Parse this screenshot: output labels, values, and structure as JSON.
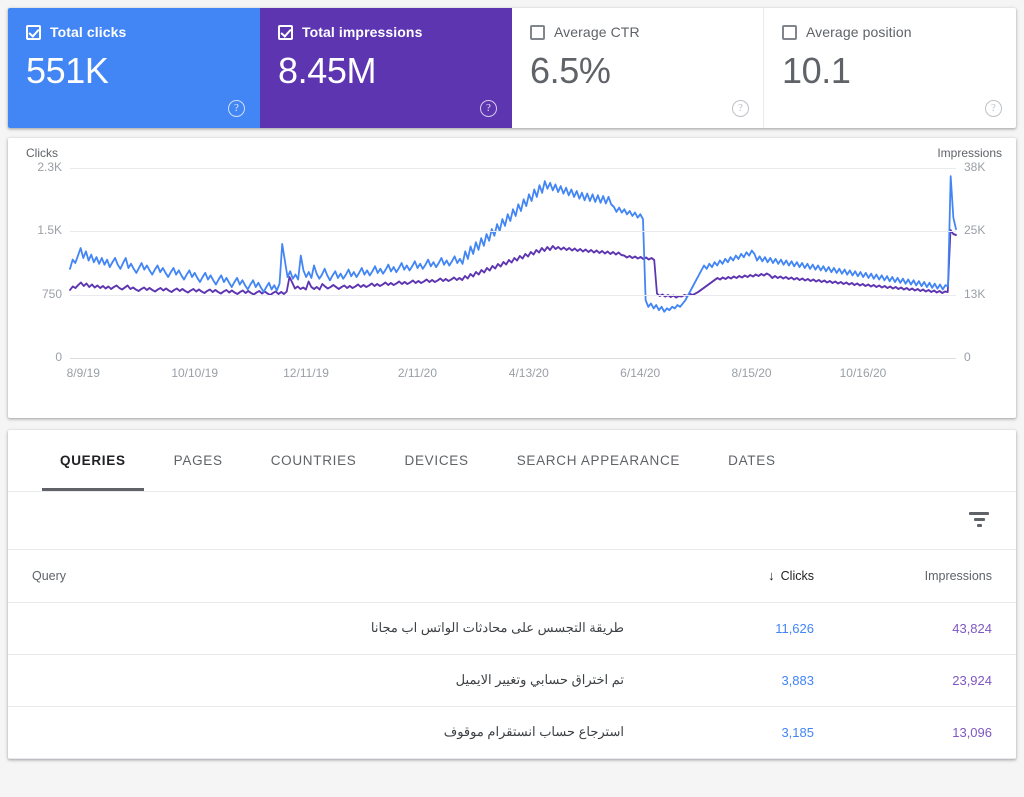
{
  "metrics": [
    {
      "label": "Total clicks",
      "value": "551K",
      "checked": true,
      "state": "sel-blue",
      "help": "?"
    },
    {
      "label": "Total impressions",
      "value": "8.45M",
      "checked": true,
      "state": "sel-purple",
      "help": "?"
    },
    {
      "label": "Average CTR",
      "value": "6.5%",
      "checked": false,
      "state": "",
      "help": "?"
    },
    {
      "label": "Average position",
      "value": "10.1",
      "checked": false,
      "state": "",
      "help": "?"
    }
  ],
  "chart": {
    "left_axis_title": "Clicks",
    "right_axis_title": "Impressions",
    "left_ticks": [
      "2.3K",
      "1.5K",
      "750",
      "0"
    ],
    "right_ticks": [
      "38K",
      "25K",
      "13K",
      "0"
    ],
    "x_ticks": [
      "8/9/19",
      "10/10/19",
      "12/11/19",
      "2/11/20",
      "4/13/20",
      "6/14/20",
      "8/15/20",
      "10/16/20"
    ],
    "clicks_color": "#4285f4",
    "impressions_color": "#5e35b1"
  },
  "chart_data": {
    "type": "line",
    "title": "",
    "xlabel": "",
    "ylabel": "Clicks",
    "y2label": "Impressions",
    "grid": true,
    "legend": "none",
    "ylim": [
      0,
      2300
    ],
    "y2lim": [
      0,
      38000
    ],
    "yticks": [
      0,
      750,
      1500,
      2300
    ],
    "y2ticks": [
      0,
      13000,
      25000,
      38000
    ],
    "x": [
      "8/9/19",
      "10/10/19",
      "12/11/19",
      "2/11/20",
      "4/13/20",
      "6/14/20",
      "8/15/20",
      "10/16/20"
    ],
    "series": [
      {
        "name": "Clicks",
        "color": "#4285f4",
        "axis": "left",
        "values": [
          1080,
          1190,
          1150,
          1240,
          1330,
          1210,
          1290,
          1180,
          1250,
          1160,
          1220,
          1140,
          1210,
          1130,
          1190,
          1100,
          1160,
          1210,
          1130,
          1080,
          1150,
          1210,
          1090,
          1140,
          1080,
          1030,
          1090,
          1150,
          1070,
          1120,
          1060,
          1010,
          1070,
          1120,
          1040,
          1090,
          1030,
          980,
          1040,
          1090,
          1010,
          1060,
          1000,
          950,
          1010,
          1060,
          980,
          1030,
          970,
          920,
          980,
          1030,
          950,
          1000,
          940,
          890,
          950,
          1000,
          920,
          970,
          910,
          860,
          920,
          970,
          890,
          940,
          880,
          830,
          890,
          940,
          860,
          910,
          850,
          800,
          860,
          910,
          830,
          880,
          820,
          900,
          1380,
          1180,
          980,
          1050,
          960,
          1010,
          950,
          1240,
          1060,
          980,
          1040,
          970,
          1120,
          1020,
          960,
          1010,
          1080,
          1000,
          940,
          1000,
          1050,
          970,
          1020,
          960,
          1010,
          1070,
          990,
          1040,
          980,
          1030,
          1090,
          1010,
          1060,
          1000,
          1050,
          1110,
          1030,
          1080,
          1020,
          1070,
          1130,
          1050,
          1100,
          1040,
          1090,
          1150,
          1070,
          1120,
          1060,
          1110,
          1170,
          1090,
          1140,
          1080,
          1130,
          1190,
          1110,
          1160,
          1100,
          1150,
          1210,
          1130,
          1180,
          1120,
          1170,
          1230,
          1150,
          1200,
          1140,
          1290,
          1200,
          1350,
          1260,
          1400,
          1310,
          1450,
          1360,
          1500,
          1420,
          1560,
          1480,
          1620,
          1540,
          1680,
          1600,
          1740,
          1660,
          1800,
          1720,
          1860,
          1780,
          1920,
          1840,
          1980,
          1900,
          2040,
          1950,
          2090,
          2000,
          2140,
          2050,
          2120,
          2030,
          2100,
          2010,
          2080,
          1990,
          2060,
          1970,
          2040,
          1950,
          2020,
          1930,
          2000,
          1910,
          1990,
          1900,
          1980,
          1890,
          1970,
          1880,
          1960,
          1870,
          1950,
          1860,
          1830,
          1770,
          1820,
          1760,
          1800,
          1740,
          1780,
          1720,
          1760,
          1700,
          1740,
          1680,
          700,
          620,
          660,
          600,
          640,
          580,
          620,
          560,
          600,
          580,
          620,
          600,
          640,
          620,
          660,
          700,
          760,
          820,
          880,
          940,
          1000,
          1060,
          1120,
          1080,
          1140,
          1100,
          1160,
          1120,
          1180,
          1140,
          1200,
          1160,
          1220,
          1180,
          1240,
          1200,
          1260,
          1220,
          1280,
          1240,
          1300,
          1260,
          1180,
          1230,
          1170,
          1220,
          1160,
          1210,
          1150,
          1200,
          1140,
          1190,
          1130,
          1180,
          1120,
          1170,
          1110,
          1160,
          1100,
          1150,
          1090,
          1140,
          1080,
          1130,
          1070,
          1120,
          1060,
          1110,
          1050,
          1100,
          1040,
          1090,
          1030,
          1080,
          1020,
          1070,
          1010,
          1060,
          1000,
          1050,
          990,
          1040,
          980,
          1030,
          970,
          1020,
          960,
          1010,
          950,
          1000,
          940,
          990,
          930,
          980,
          920,
          970,
          910,
          960,
          900,
          950,
          890,
          940,
          880,
          930,
          870,
          920,
          860,
          910,
          850,
          900,
          840,
          890,
          830,
          880,
          870,
          2200,
          1700,
          1560
        ]
      },
      {
        "name": "Impressions",
        "color": "#5e35b1",
        "axis": "right",
        "values": [
          13600,
          14300,
          14000,
          14600,
          15100,
          14400,
          14900,
          14200,
          14700,
          14100,
          14500,
          14000,
          14400,
          13900,
          14300,
          13800,
          14200,
          14500,
          14000,
          13700,
          14100,
          14500,
          13800,
          14100,
          13700,
          13400,
          13800,
          14100,
          13600,
          14000,
          13600,
          13300,
          13700,
          14000,
          13500,
          13900,
          13500,
          13200,
          13600,
          13900,
          13400,
          13800,
          13400,
          13100,
          13500,
          13800,
          13300,
          13700,
          13300,
          13000,
          13400,
          13700,
          13200,
          13600,
          13200,
          12900,
          13300,
          13600,
          13100,
          13500,
          13100,
          12800,
          13200,
          13500,
          13000,
          13400,
          13000,
          12700,
          13100,
          13400,
          12900,
          13300,
          12900,
          12600,
          13000,
          13300,
          12800,
          13200,
          12800,
          13300,
          16200,
          15100,
          13900,
          14300,
          13800,
          14100,
          13700,
          15300,
          14200,
          13800,
          14200,
          13700,
          14800,
          14300,
          13900,
          14200,
          14600,
          14200,
          13800,
          14200,
          14500,
          14000,
          14400,
          14000,
          14300,
          14700,
          14200,
          14600,
          14200,
          14500,
          14900,
          14400,
          14800,
          14400,
          14700,
          15100,
          14600,
          15000,
          14600,
          14900,
          15300,
          14800,
          15200,
          14800,
          15100,
          15500,
          15000,
          15400,
          15000,
          15300,
          15700,
          15200,
          15600,
          15200,
          15500,
          15900,
          15400,
          15800,
          15400,
          15700,
          16100,
          15600,
          16000,
          15600,
          16400,
          15900,
          16800,
          16300,
          17200,
          16700,
          17600,
          17100,
          18000,
          17500,
          18400,
          17900,
          18800,
          18300,
          19200,
          18700,
          19600,
          19100,
          20000,
          19500,
          20400,
          19900,
          20800,
          20300,
          21200,
          20700,
          21600,
          21100,
          22000,
          21400,
          22200,
          21600,
          22400,
          21800,
          22200,
          21700,
          22100,
          21600,
          22000,
          21500,
          21900,
          21400,
          21800,
          21300,
          21700,
          21200,
          21600,
          21100,
          21500,
          21000,
          21400,
          20900,
          21300,
          20800,
          21200,
          20700,
          21100,
          20600,
          20500,
          20100,
          20400,
          20000,
          20300,
          19900,
          20200,
          19800,
          20100,
          19700,
          20000,
          19600,
          12900,
          12400,
          12700,
          12300,
          12600,
          12200,
          12500,
          12100,
          12400,
          12300,
          12600,
          12400,
          12800,
          12600,
          12900,
          13200,
          13600,
          14000,
          14400,
          14800,
          15200,
          15600,
          16000,
          15700,
          16100,
          15800,
          16200,
          15900,
          16300,
          16000,
          16400,
          16100,
          16500,
          16200,
          16600,
          16300,
          16700,
          16400,
          16800,
          16500,
          16900,
          16600,
          16000,
          16400,
          16000,
          16300,
          15900,
          16200,
          15800,
          16100,
          15700,
          16000,
          15600,
          15900,
          15500,
          15800,
          15400,
          15700,
          15300,
          15600,
          15200,
          15500,
          15100,
          15400,
          15000,
          15300,
          14900,
          15200,
          14800,
          15100,
          14700,
          15000,
          14600,
          14900,
          14500,
          14800,
          14400,
          14700,
          14300,
          14600,
          14200,
          14500,
          14100,
          14400,
          14000,
          14300,
          13900,
          14200,
          13800,
          14100,
          13700,
          14000,
          13600,
          13900,
          13500,
          13800,
          13400,
          13700,
          13300,
          13600,
          13200,
          13500,
          13100,
          13400,
          13000,
          13300,
          13200,
          25600,
          24800,
          24600
        ]
      }
    ]
  },
  "table": {
    "tabs": [
      {
        "label": "QUERIES",
        "active": true
      },
      {
        "label": "PAGES",
        "active": false
      },
      {
        "label": "COUNTRIES",
        "active": false
      },
      {
        "label": "DEVICES",
        "active": false
      },
      {
        "label": "SEARCH APPEARANCE",
        "active": false
      },
      {
        "label": "DATES",
        "active": false
      }
    ],
    "filter_icon": "filter-icon",
    "columns": {
      "query": "Query",
      "clicks": "Clicks",
      "impressions": "Impressions",
      "sort_arrow": "↓"
    },
    "rows": [
      {
        "query": "طريقة التجسس على محادثات الواتس اب مجانا",
        "clicks": "11,626",
        "impressions": "43,824"
      },
      {
        "query": "تم اختراق حسابي وتغيير الايميل",
        "clicks": "3,883",
        "impressions": "23,924"
      },
      {
        "query": "استرجاع حساب انستقرام موقوف",
        "clicks": "3,185",
        "impressions": "13,096"
      }
    ]
  }
}
